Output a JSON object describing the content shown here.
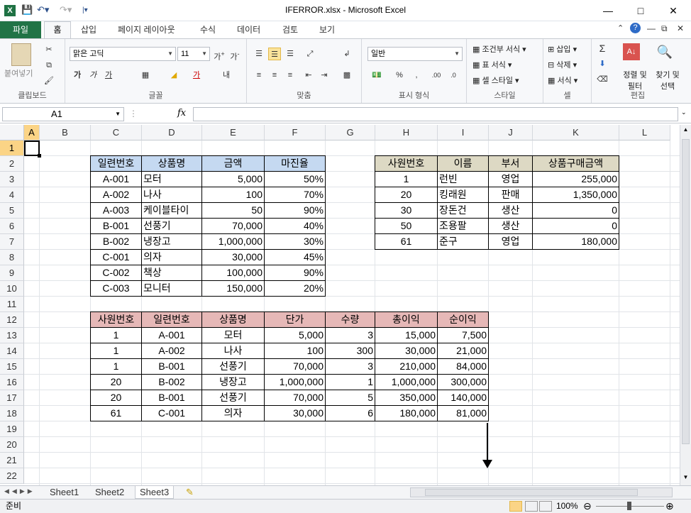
{
  "app": {
    "title": "IFERROR.xlsx  -  Microsoft Excel"
  },
  "tabs": [
    "파일",
    "홈",
    "삽입",
    "페이지 레이아웃",
    "수식",
    "데이터",
    "검토",
    "보기"
  ],
  "ribbon": {
    "clipboard": {
      "label": "클립보드",
      "paste": "붙여넣기"
    },
    "font": {
      "label": "글꼴",
      "name": "맑은 고딕",
      "size": "11",
      "bold": "가",
      "italic": "가",
      "underline": "가"
    },
    "align": {
      "label": "맞춤"
    },
    "number": {
      "label": "표시 형식",
      "format": "일반"
    },
    "style": {
      "label": "스타일",
      "cond": "조건부 서식",
      "table": "표 서식",
      "cell": "셀 스타일"
    },
    "cells": {
      "label": "셀",
      "insert": "삽입",
      "delete": "삭제",
      "format": "서식"
    },
    "edit": {
      "label": "편집",
      "sort": "정렬 및 필터",
      "find": "찾기 및 선택"
    }
  },
  "formula_bar": {
    "namebox": "A1",
    "fx": "fx",
    "value": ""
  },
  "columns": [
    "A",
    "B",
    "C",
    "D",
    "E",
    "F",
    "G",
    "H",
    "I",
    "J",
    "K",
    "L"
  ],
  "rows": [
    "1",
    "2",
    "3",
    "4",
    "5",
    "6",
    "7",
    "8",
    "9",
    "10",
    "11",
    "12",
    "13",
    "14",
    "15",
    "16",
    "17",
    "18",
    "19",
    "20",
    "21",
    "22"
  ],
  "table1": {
    "headers": [
      "일련번호",
      "상품명",
      "금액",
      "마진율"
    ],
    "rows": [
      [
        "A-001",
        "모터",
        "5,000",
        "50%"
      ],
      [
        "A-002",
        "나사",
        "100",
        "70%"
      ],
      [
        "A-003",
        "케이블타이",
        "50",
        "90%"
      ],
      [
        "B-001",
        "선풍기",
        "70,000",
        "40%"
      ],
      [
        "B-002",
        "냉장고",
        "1,000,000",
        "30%"
      ],
      [
        "C-001",
        "의자",
        "30,000",
        "45%"
      ],
      [
        "C-002",
        "책상",
        "100,000",
        "90%"
      ],
      [
        "C-003",
        "모니터",
        "150,000",
        "20%"
      ]
    ]
  },
  "table2": {
    "headers": [
      "사원번호",
      "이름",
      "부서",
      "상품구매금액"
    ],
    "rows": [
      [
        "1",
        "런빈",
        "영업",
        "255,000"
      ],
      [
        "20",
        "킹래원",
        "판매",
        "1,350,000"
      ],
      [
        "30",
        "장돈건",
        "생산",
        "0"
      ],
      [
        "50",
        "조용팔",
        "생산",
        "0"
      ],
      [
        "61",
        "준구",
        "영업",
        "180,000"
      ]
    ]
  },
  "table3": {
    "headers": [
      "사원번호",
      "일련번호",
      "상품명",
      "단가",
      "수량",
      "총이익",
      "순이익"
    ],
    "rows": [
      [
        "1",
        "A-001",
        "모터",
        "5,000",
        "3",
        "15,000",
        "7,500"
      ],
      [
        "1",
        "A-002",
        "나사",
        "100",
        "300",
        "30,000",
        "21,000"
      ],
      [
        "1",
        "B-001",
        "선풍기",
        "70,000",
        "3",
        "210,000",
        "84,000"
      ],
      [
        "20",
        "B-002",
        "냉장고",
        "1,000,000",
        "1",
        "1,000,000",
        "300,000"
      ],
      [
        "20",
        "B-001",
        "선풍기",
        "70,000",
        "5",
        "350,000",
        "140,000"
      ],
      [
        "61",
        "C-001",
        "의자",
        "30,000",
        "6",
        "180,000",
        "81,000"
      ]
    ]
  },
  "sheets": [
    "Sheet1",
    "Sheet2",
    "Sheet3"
  ],
  "status": {
    "ready": "준비",
    "zoom": "100%"
  },
  "colors": {
    "accent": "#217346",
    "header_blue": "#c5d9f1",
    "header_pink": "#e6b8b7",
    "header_tan": "#ddd9c4"
  }
}
